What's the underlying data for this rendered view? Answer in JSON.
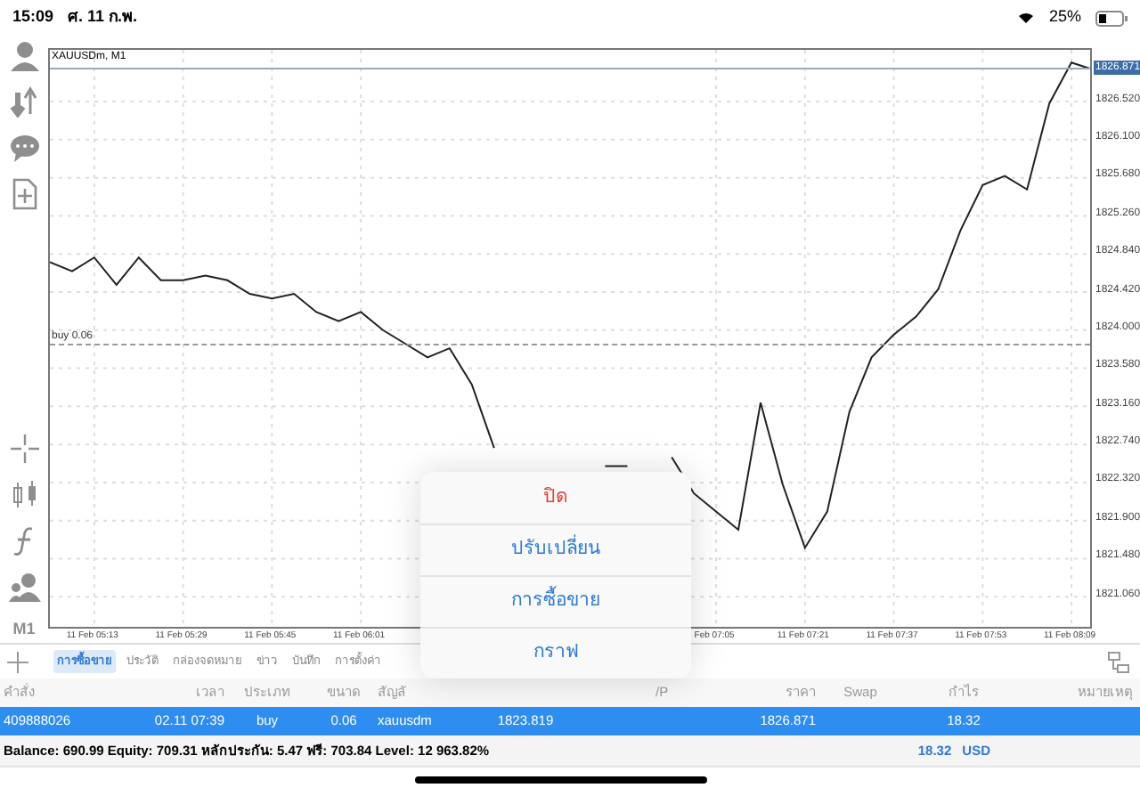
{
  "status_bar": {
    "time": "15:09",
    "date": "ศ. 11 ก.พ.",
    "battery": "25%"
  },
  "toolbar": {
    "timeframe": "M1"
  },
  "chart": {
    "symbol": "XAUUSDm, M1",
    "order_line": "buy 0.06",
    "current_price": "1826.871",
    "chart_data": {
      "type": "line",
      "grid": true,
      "ylim": [
        1820.69,
        1827.09
      ],
      "yticks": [
        {
          "value": 1826.52,
          "label": "1826.520"
        },
        {
          "value": 1826.1,
          "label": "1826.100"
        },
        {
          "value": 1825.68,
          "label": "1825.680"
        },
        {
          "value": 1825.26,
          "label": "1825.260"
        },
        {
          "value": 1824.84,
          "label": "1824.840"
        },
        {
          "value": 1824.42,
          "label": "1824.420"
        },
        {
          "value": 1824.0,
          "label": "1824.000"
        },
        {
          "value": 1823.58,
          "label": "1823.580"
        },
        {
          "value": 1823.16,
          "label": "1823.160"
        },
        {
          "value": 1822.74,
          "label": "1822.740"
        },
        {
          "value": 1822.32,
          "label": "1822.320"
        },
        {
          "value": 1821.9,
          "label": "1821.900"
        },
        {
          "value": 1821.48,
          "label": "1821.480"
        },
        {
          "value": 1821.06,
          "label": "1821.060"
        }
      ],
      "categories": [
        null,
        null,
        "11 Feb 05:13",
        null,
        null,
        null,
        "11 Feb 05:29",
        null,
        null,
        null,
        "11 Feb 05:45",
        null,
        null,
        null,
        "11 Feb 06:01",
        null,
        null,
        null,
        null,
        null,
        null,
        null,
        null,
        null,
        null,
        null,
        null,
        null,
        null,
        null,
        "Feb 07:05",
        null,
        null,
        null,
        "11 Feb 07:21",
        null,
        null,
        null,
        "11 Feb 07:37",
        null,
        null,
        null,
        "11 Feb 07:53",
        null,
        null,
        null,
        "11 Feb 08:09",
        null
      ],
      "series": [
        {
          "color": "#222222",
          "values": [
            1824.75,
            1824.65,
            1824.8,
            1824.5,
            1824.8,
            1824.55,
            1824.55,
            1824.6,
            1824.55,
            1824.4,
            1824.35,
            1824.4,
            1824.2,
            1824.1,
            1824.2,
            1824.0,
            1823.85,
            1823.7,
            1823.8,
            1823.4,
            1822.7,
            null,
            null,
            null,
            null,
            1822.5,
            1822.5,
            null,
            1822.6,
            1822.2,
            1822.0,
            1821.8,
            1823.2,
            1822.3,
            1821.6,
            1822.0,
            1823.1,
            1823.7,
            1823.95,
            1824.15,
            1824.45,
            1825.1,
            1825.6,
            1825.7,
            1825.55,
            1826.5,
            1826.95,
            1826.87
          ]
        }
      ]
    }
  },
  "popup_menu": [
    {
      "label": "ปิด",
      "kind": "destructive"
    },
    {
      "label": "ปรับเปลี่ยน",
      "kind": "normal"
    },
    {
      "label": "การซื้อขาย",
      "kind": "normal"
    },
    {
      "label": "กราฟ",
      "kind": "normal"
    }
  ],
  "tabs": [
    {
      "label": "การซื้อขาย",
      "selected": true
    },
    {
      "label": "ประวัติ",
      "selected": false
    },
    {
      "label": "กล่องจดหมาย",
      "selected": false
    },
    {
      "label": "ข่าว",
      "selected": false
    },
    {
      "label": "บันทึก",
      "selected": false
    },
    {
      "label": "การตั้งค่า",
      "selected": false
    }
  ],
  "table": {
    "columns": [
      {
        "label": "คำสั่ง"
      },
      {
        "label": "เวลา"
      },
      {
        "label": "ประเภท"
      },
      {
        "label": "ขนาด"
      },
      {
        "label": "สัญลั"
      },
      {},
      {},
      {
        "label": "/P"
      },
      {
        "label": "ราคา"
      },
      {
        "label": "Swap"
      },
      {
        "label": "กำไร"
      },
      {
        "label": "หมายเหตุ"
      }
    ],
    "rows": [
      {
        "selected": true,
        "cells": [
          "409888026",
          "02.11 07:39",
          "buy",
          "0.06",
          "xauusdm",
          "1823.819",
          "",
          "",
          "1826.871",
          "",
          "18.32",
          ""
        ]
      }
    ]
  },
  "summary": {
    "text": "Balance: 690.99 Equity: 709.31 หลักประกัน: 5.47 ฟรี: 703.84 Level: 12 963.82%",
    "profit": "18.32",
    "currency": "USD"
  }
}
